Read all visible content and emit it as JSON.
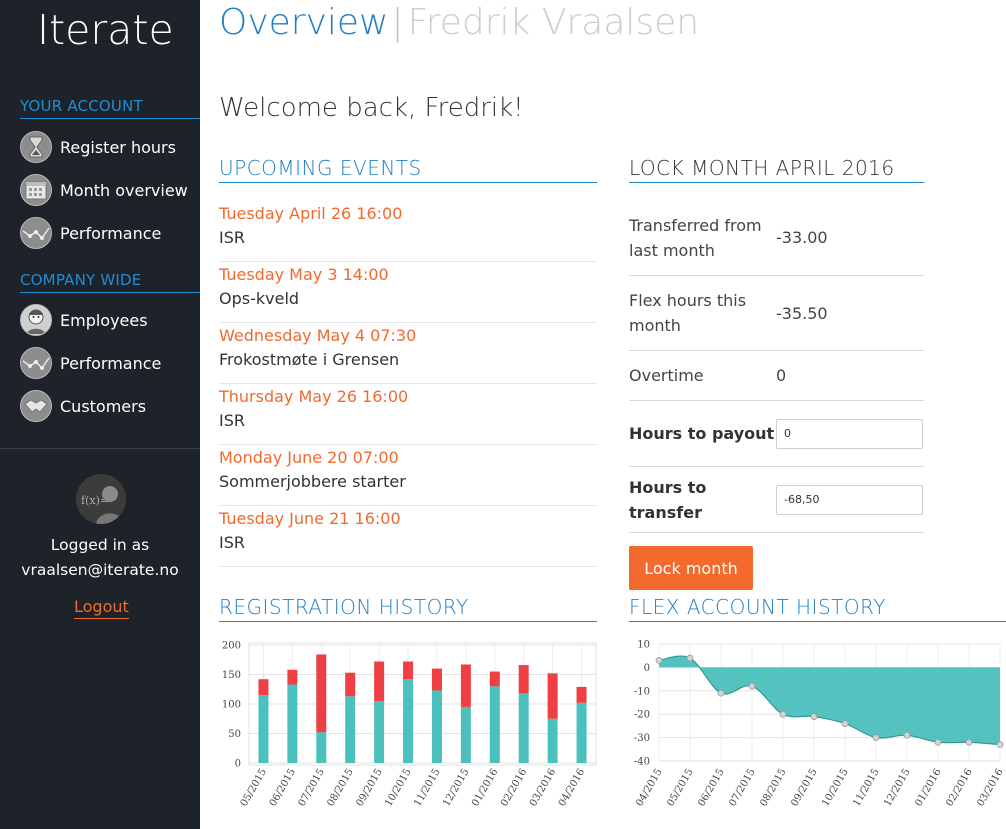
{
  "sidebar": {
    "brand": "Iterate",
    "account_section": "YOUR ACCOUNT",
    "account_items": [
      {
        "label": "Register hours",
        "icon": "hourglass-icon"
      },
      {
        "label": "Month overview",
        "icon": "calendar-icon"
      },
      {
        "label": "Performance",
        "icon": "line-chart-icon"
      }
    ],
    "company_section": "COMPANY WIDE",
    "company_items": [
      {
        "label": "Employees",
        "icon": "employee-icon"
      },
      {
        "label": "Performance",
        "icon": "line-chart-icon"
      },
      {
        "label": "Customers",
        "icon": "handshake-icon"
      }
    ],
    "logged_in_line1": "Logged in as",
    "logged_in_line2": "vraalsen@iterate.no",
    "logout": "Logout"
  },
  "header": {
    "title": "Overview",
    "separator": "|",
    "subtitle": "Fredrik Vraalsen"
  },
  "welcome": "Welcome back, Fredrik!",
  "events": {
    "heading": "UPCOMING EVENTS",
    "items": [
      {
        "when": "Tuesday April 26 16:00",
        "what": "ISR"
      },
      {
        "when": "Tuesday May 3 14:00",
        "what": "Ops-kveld"
      },
      {
        "when": "Wednesday May 4 07:30",
        "what": "Frokostmøte i Grensen"
      },
      {
        "when": "Thursday May 26 16:00",
        "what": "ISR"
      },
      {
        "when": "Monday June 20 07:00",
        "what": "Sommerjobbere starter"
      },
      {
        "when": "Tuesday June 21 16:00",
        "what": "ISR"
      }
    ]
  },
  "lock": {
    "heading": "LOCK MONTH APRIL 2016",
    "transferred_label": "Transferred from last month",
    "transferred_value": "-33.00",
    "flex_label": "Flex hours this month",
    "flex_value": "-35.50",
    "overtime_label": "Overtime",
    "overtime_value": "0",
    "payout_label": "Hours to payout",
    "payout_value": "0",
    "transfer_label": "Hours to transfer",
    "transfer_value": "-68,50",
    "button": "Lock month"
  },
  "registration_history": {
    "heading": "REGISTRATION HISTORY"
  },
  "flex_history": {
    "heading": "FLEX ACCOUNT HISTORY"
  },
  "colors": {
    "accent_blue": "#1f7fc4",
    "orange": "#f06a2f",
    "teal": "#4bc0bd",
    "red": "#ee4044",
    "sidebar_bg": "#1e2229"
  },
  "chart_data": [
    {
      "type": "bar",
      "stacked": true,
      "categories": [
        "05/2015",
        "06/2015",
        "07/2015",
        "08/2015",
        "09/2015",
        "10/2015",
        "11/2015",
        "12/2015",
        "01/2016",
        "02/2016",
        "03/2016",
        "04/2016"
      ],
      "series": [
        {
          "color": "#4bc0bd",
          "values": [
            115,
            133,
            52,
            113,
            105,
            142,
            123,
            95,
            130,
            118,
            75,
            102
          ]
        },
        {
          "color": "#ee4044",
          "values": [
            27,
            25,
            132,
            40,
            67,
            30,
            37,
            72,
            25,
            48,
            77,
            27
          ]
        }
      ],
      "ylim": [
        0,
        200
      ],
      "yticks": [
        0,
        50,
        100,
        150,
        200
      ],
      "grid": true
    },
    {
      "type": "area",
      "x": [
        "04/2015",
        "05/2015",
        "06/2015",
        "07/2015",
        "08/2015",
        "09/2015",
        "10/2015",
        "11/2015",
        "12/2015",
        "01/2016",
        "02/2016",
        "03/2016"
      ],
      "values": [
        3,
        4,
        -11,
        -8,
        -20,
        -21,
        -24,
        -30,
        -29,
        -32,
        -32,
        -33
      ],
      "ylim": [
        -40,
        10
      ],
      "yticks": [
        10,
        0,
        -10,
        -20,
        -30,
        -40
      ],
      "color": "#4bc0bd",
      "grid": true
    }
  ]
}
